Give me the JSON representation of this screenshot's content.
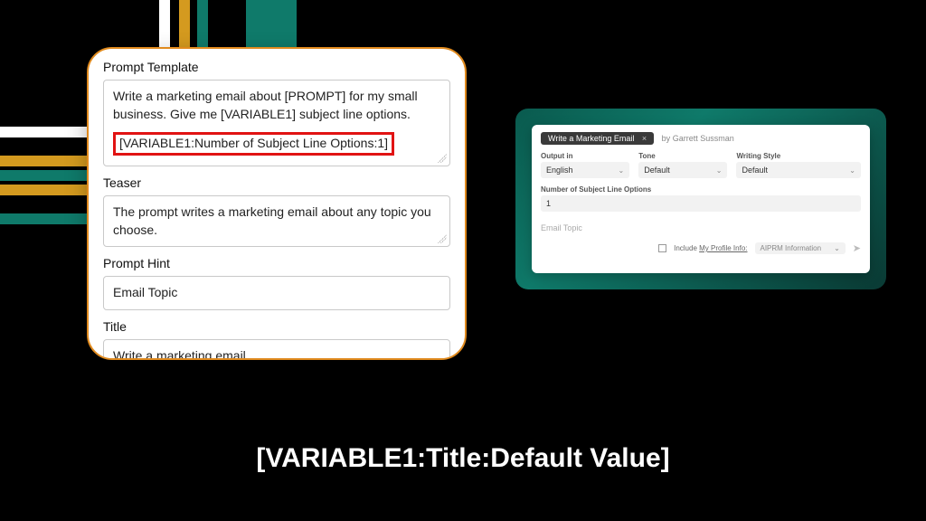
{
  "left_panel": {
    "prompt_template_label": "Prompt Template",
    "prompt_template_line1": "Write a marketing email about [PROMPT] for my small business. Give me [VARIABLE1] subject line options.",
    "prompt_template_highlight": "[VARIABLE1:Number of Subject Line Options:1]",
    "teaser_label": "Teaser",
    "teaser_value": "The prompt writes a marketing email about any topic you choose.",
    "prompt_hint_label": "Prompt Hint",
    "prompt_hint_value": "Email Topic",
    "title_label": "Title",
    "title_value": "Write a marketing email"
  },
  "right_panel": {
    "chip_label": "Write a Marketing Email",
    "chip_close": "×",
    "by_label": "by",
    "author": "Garrett Sussman",
    "output_in_label": "Output in",
    "output_in_value": "English",
    "tone_label": "Tone",
    "tone_value": "Default",
    "writing_style_label": "Writing Style",
    "writing_style_value": "Default",
    "variable_label": "Number of Subject Line Options",
    "variable_value": "1",
    "email_topic_placeholder": "Email Topic",
    "include_label": "Include",
    "profile_link": "My Profile Info:",
    "profile_select": "AIPRM Information"
  },
  "caption": "[VARIABLE1:Title:Default Value]"
}
